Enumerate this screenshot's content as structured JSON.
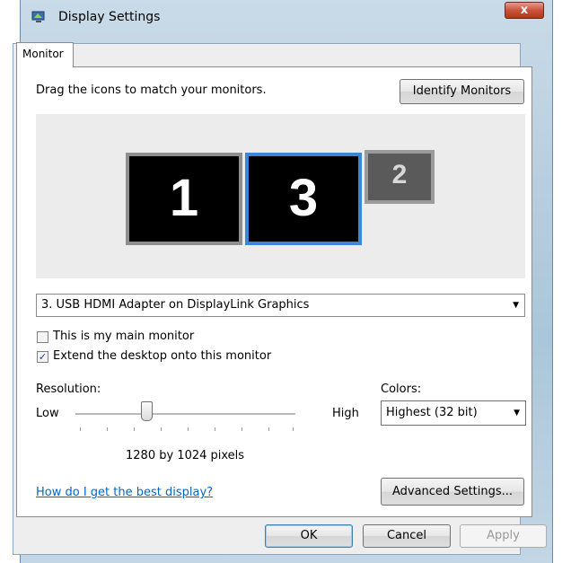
{
  "window": {
    "title": "Display Settings",
    "close_label": "x"
  },
  "tabs": [
    {
      "label": "Monitor"
    }
  ],
  "monitor_tab": {
    "instruction": "Drag the icons to match your monitors.",
    "identify_button": "Identify Monitors",
    "monitors": [
      {
        "number": "1"
      },
      {
        "number": "3",
        "selected": true
      },
      {
        "number": "2"
      }
    ],
    "display_select": "3. USB HDMI Adapter on DisplayLink Graphics",
    "main_monitor_label": "This is my main monitor",
    "main_monitor_checked": false,
    "extend_label": "Extend the desktop onto this monitor",
    "extend_checked": true,
    "resolution_label": "Resolution:",
    "low_label": "Low",
    "high_label": "High",
    "resolution_value": "1280 by 1024 pixels",
    "colors_label": "Colors:",
    "colors_select": "Highest (32 bit)",
    "help_link": "How do I get the best display?",
    "advanced_button": "Advanced Settings..."
  },
  "footer": {
    "ok": "OK",
    "cancel": "Cancel",
    "apply": "Apply"
  },
  "colors": {
    "selected_monitor_border": "#3b86d9",
    "link": "#0066cc"
  }
}
